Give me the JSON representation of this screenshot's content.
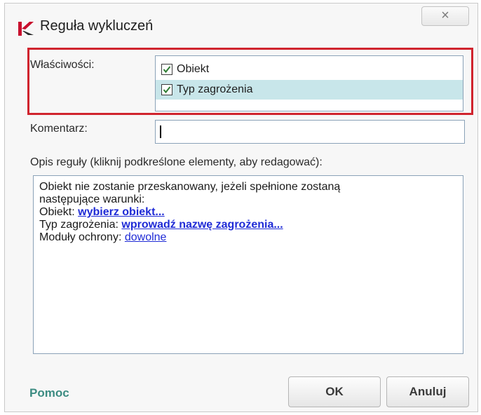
{
  "window": {
    "title": "Reguła wykluczeń",
    "close_glyph": "×",
    "logo_icon": "kaspersky-logo-icon"
  },
  "properties": {
    "label": "Właściwości:",
    "items": [
      {
        "label": "Obiekt",
        "checked": true,
        "selected": false
      },
      {
        "label": "Typ zagrożenia",
        "checked": true,
        "selected": true
      }
    ]
  },
  "comment": {
    "label": "Komentarz:",
    "value": ""
  },
  "rule": {
    "heading": "Opis reguły (kliknij podkreślone elementy, aby redagować):",
    "line1": "Obiekt nie zostanie przeskanowany, jeżeli spełnione zostaną",
    "line2": "następujące warunki:",
    "object_prefix": "Obiekt: ",
    "object_link": "wybierz obiekt...",
    "threat_prefix": "Typ zagrożenia: ",
    "threat_link": "wprowadź nazwę zagrożenia...",
    "modules_prefix": "Moduły ochrony: ",
    "modules_link": "dowolne"
  },
  "footer": {
    "help": "Pomoc",
    "ok": "OK",
    "cancel": "Anuluj"
  },
  "colors": {
    "highlight_border": "#d0242e",
    "link": "#1f2bd6",
    "help": "#3c8c82",
    "selected_row": "#c8e6ea"
  }
}
